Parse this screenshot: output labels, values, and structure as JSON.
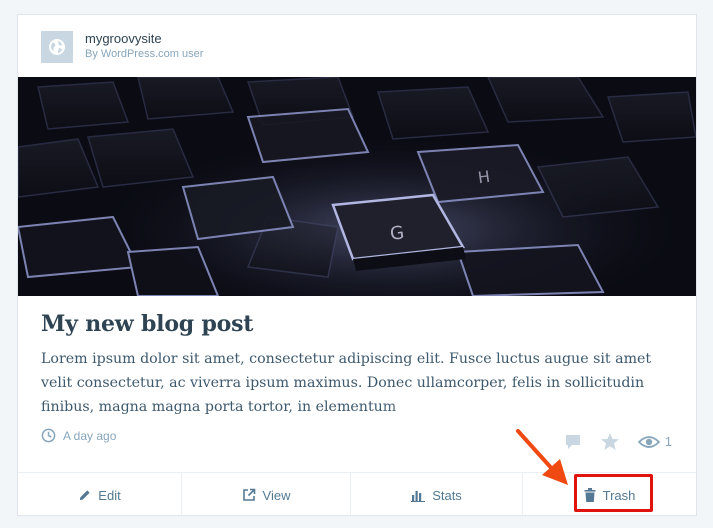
{
  "site": {
    "name": "mygroovysite",
    "byline": "By WordPress.com user",
    "icon": "globe-icon"
  },
  "post": {
    "title": "My new blog post",
    "excerpt": "Lorem ipsum dolor sit amet, consectetur adipiscing elit. Fusce luctus augue sit amet velit consectetur, ac viverra ipsum maximus. Donec ullamcorper, felis in sollicitudin finibus, magna magna porta tortor, in elementum",
    "time": "A day ago",
    "views": "1"
  },
  "actions": {
    "edit": "Edit",
    "view": "View",
    "stats": "Stats",
    "trash": "Trash"
  },
  "colors": {
    "accent_highlight": "#e1130d",
    "text_primary": "#2e4453",
    "text_muted": "#87a6bc"
  }
}
